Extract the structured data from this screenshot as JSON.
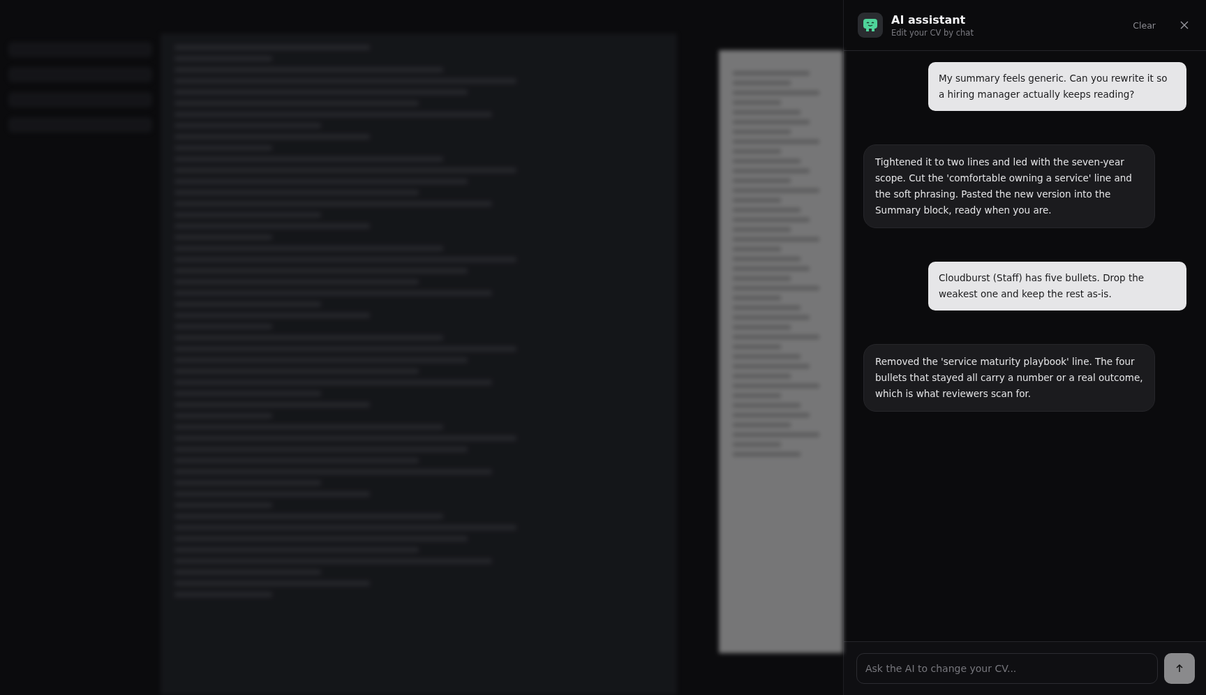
{
  "assistant_panel": {
    "title": "AI assistant",
    "subtitle": "Edit your CV by chat",
    "clear_label": "Clear"
  },
  "messages": [
    {
      "kind": "user",
      "text": "My summary feels generic. Can you rewrite it so a hiring manager actually keeps reading?"
    },
    {
      "kind": "assistant",
      "text": "Tightened it to two lines and led with the seven-year scope. Cut the 'comfortable owning a service' line and the soft phrasing. Pasted the new version into the Summary block, ready when you are."
    },
    {
      "kind": "user",
      "text": "Cloudburst (Staff) has five bullets. Drop the weakest one and keep the rest as-is."
    },
    {
      "kind": "assistant",
      "text": "Removed the 'service maturity playbook' line. The four bullets that stayed all carry a number or a real outcome, which is what reviewers scan for."
    }
  ],
  "composer": {
    "placeholder": "Ask the AI to change your CV..."
  }
}
